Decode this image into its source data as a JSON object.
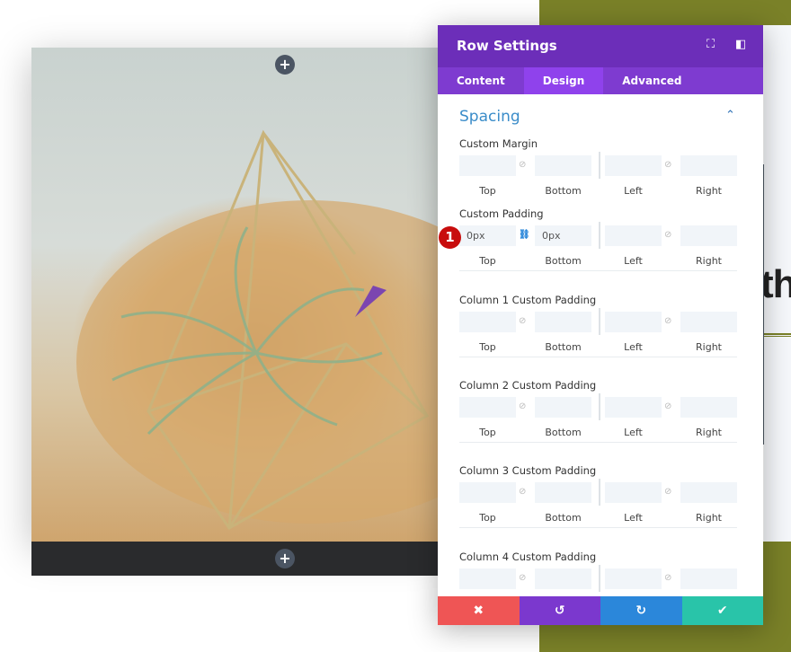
{
  "panel": {
    "title": "Row Settings",
    "tabs": [
      {
        "label": "Content",
        "active": false
      },
      {
        "label": "Design",
        "active": true
      },
      {
        "label": "Advanced",
        "active": false
      }
    ]
  },
  "section": {
    "title": "Spacing"
  },
  "groups": [
    {
      "label": "Custom Margin",
      "values": [
        "",
        "",
        "",
        ""
      ],
      "linked": false
    },
    {
      "label": "Custom Padding",
      "values": [
        "0px",
        "0px",
        "",
        ""
      ],
      "linked": true
    },
    {
      "label": "Column 1 Custom Padding",
      "values": [
        "",
        "",
        "",
        ""
      ],
      "linked": false
    },
    {
      "label": "Column 2 Custom Padding",
      "values": [
        "",
        "",
        "",
        ""
      ],
      "linked": false
    },
    {
      "label": "Column 3 Custom Padding",
      "values": [
        "",
        "",
        "",
        ""
      ],
      "linked": false
    },
    {
      "label": "Column 4 Custom Padding",
      "values": [
        "",
        "",
        "",
        ""
      ],
      "linked": false
    }
  ],
  "sublabels": [
    "Top",
    "Bottom",
    "Left",
    "Right"
  ],
  "badge": "1",
  "background_heading_fragment": "th",
  "icons": {
    "cancel": "✖",
    "undo": "↺",
    "redo": "↻",
    "save": "✔",
    "plus": "+"
  },
  "colors": {
    "header": "#6c2eb9",
    "tabs": "#7e3bd0",
    "cancel": "#ef5555",
    "undo": "#7b38ce",
    "redo": "#2b87da",
    "save": "#29c4a9",
    "accent": "#7a8128"
  }
}
